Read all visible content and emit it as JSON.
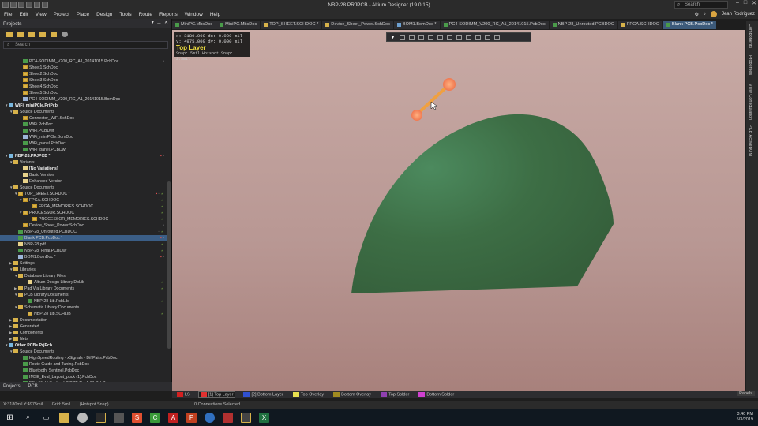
{
  "window": {
    "title": "NBP-28.PRJPCB - Altium Designer (19.0.15)",
    "search_placeholder": "Search",
    "user": "Jean Rodriguez"
  },
  "menu": [
    "File",
    "Edit",
    "View",
    "Project",
    "Place",
    "Design",
    "Tools",
    "Route",
    "Reports",
    "Window",
    "Help"
  ],
  "projects_panel": {
    "title": "Projects",
    "search_placeholder": "Search",
    "tree": [
      {
        "indent": 4,
        "icon": "pcb",
        "label": "PC4-SODIMM_V200_RC_A1_20141015.PcbDoc",
        "flags": "doc"
      },
      {
        "indent": 4,
        "icon": "sch",
        "label": "Sheet1.SchDoc"
      },
      {
        "indent": 4,
        "icon": "sch",
        "label": "Sheet2.SchDoc"
      },
      {
        "indent": 4,
        "icon": "sch",
        "label": "Sheet3.SchDoc"
      },
      {
        "indent": 4,
        "icon": "sch",
        "label": "Sheet4.SchDoc"
      },
      {
        "indent": 4,
        "icon": "sch",
        "label": "Sheet5.SchDoc"
      },
      {
        "indent": 4,
        "icon": "bom",
        "label": "PC4-SODIMM_V200_RC_A1_20141015.BomDoc"
      },
      {
        "indent": 1,
        "icon": "prj",
        "label": "WiFi_miniPCIe.PrjPcb",
        "bold": true,
        "tri": "▼"
      },
      {
        "indent": 2,
        "icon": "folder",
        "label": "Source Documents",
        "tri": "▼"
      },
      {
        "indent": 4,
        "icon": "sch",
        "label": "Connector_WiFi.SchDoc"
      },
      {
        "indent": 4,
        "icon": "pcb",
        "label": "WiFi.PcbDoc"
      },
      {
        "indent": 4,
        "icon": "pcb",
        "label": "WiFi.PCBDwf"
      },
      {
        "indent": 4,
        "icon": "bom",
        "label": "WiFi_miniPCIe.BomDoc"
      },
      {
        "indent": 4,
        "icon": "pcb",
        "label": "WiFi_panel.PcbDoc"
      },
      {
        "indent": 4,
        "icon": "pcb",
        "label": "WiFi_panel.PCBDwf"
      },
      {
        "indent": 1,
        "icon": "prj",
        "label": "NBP-28.PRJPCB *",
        "bold": true,
        "tri": "▼",
        "flags": "red-doc"
      },
      {
        "indent": 2,
        "icon": "folder",
        "label": "Variants",
        "tri": "▼"
      },
      {
        "indent": 4,
        "icon": "doc",
        "label": "[No Variations]",
        "bold": true
      },
      {
        "indent": 4,
        "icon": "doc",
        "label": "Basic Version"
      },
      {
        "indent": 4,
        "icon": "doc",
        "label": "Enhanced Version"
      },
      {
        "indent": 2,
        "icon": "folder",
        "label": "Source Documents",
        "tri": "▼"
      },
      {
        "indent": 3,
        "icon": "sch",
        "label": "TOP_SHEET.SCHDOC *",
        "tri": "▼",
        "flags": "red-doc-check"
      },
      {
        "indent": 4,
        "icon": "sch",
        "label": "FPGA.SCHDOC",
        "tri": "▼",
        "flags": "doc-check"
      },
      {
        "indent": 6,
        "icon": "sch",
        "label": "FPGA_MEMORIES.SCHDOC",
        "flags": "check"
      },
      {
        "indent": 4,
        "icon": "sch",
        "label": "PROCESSOR.SCHDOC",
        "tri": "▼",
        "flags": "check"
      },
      {
        "indent": 6,
        "icon": "sch",
        "label": "PROCESSOR_MEMORIES.SCHDOC",
        "flags": "check"
      },
      {
        "indent": 4,
        "icon": "sch",
        "label": "Device_Sheet_Power.SchDoc",
        "flags": "doc"
      },
      {
        "indent": 3,
        "icon": "pcb",
        "label": "NBP-28_Unrouted.PCBDOC",
        "flags": "doc-check"
      },
      {
        "indent": 3,
        "icon": "pcb",
        "label": "Blank PCB.PcbDoc *",
        "selected": true,
        "flags": "red-doc"
      },
      {
        "indent": 3,
        "icon": "doc",
        "label": "NBP-28.pdf",
        "flags": "check"
      },
      {
        "indent": 3,
        "icon": "pcb",
        "label": "NBP-28_Final.PCBDwf",
        "flags": "check"
      },
      {
        "indent": 3,
        "icon": "bom",
        "label": "BOM1.BomDoc *",
        "flags": "red-doc"
      },
      {
        "indent": 2,
        "icon": "folder",
        "label": "Settings",
        "tri": "▶"
      },
      {
        "indent": 2,
        "icon": "folder",
        "label": "Libraries",
        "tri": "▼"
      },
      {
        "indent": 3,
        "icon": "folder",
        "label": "Database Library Files",
        "tri": "▼"
      },
      {
        "indent": 5,
        "icon": "doc",
        "label": "Altium Design Library.DbLib",
        "flags": "check"
      },
      {
        "indent": 3,
        "icon": "folder",
        "label": "Pad Via Library Documents",
        "tri": "▶",
        "flags": "check"
      },
      {
        "indent": 3,
        "icon": "folder",
        "label": "PCB Library Documents",
        "tri": "▼"
      },
      {
        "indent": 5,
        "icon": "pcb",
        "label": "NBP-28 Lib.PcbLib",
        "flags": "check"
      },
      {
        "indent": 3,
        "icon": "folder",
        "label": "Schematic Library Documents",
        "tri": "▼"
      },
      {
        "indent": 5,
        "icon": "sch",
        "label": "NBP-28 Lib.SCHLIB",
        "flags": "check"
      },
      {
        "indent": 2,
        "icon": "folder",
        "label": "Documentation",
        "tri": "▶"
      },
      {
        "indent": 2,
        "icon": "folder",
        "label": "Generated",
        "tri": "▶"
      },
      {
        "indent": 2,
        "icon": "folder",
        "label": "Components",
        "tri": "▶"
      },
      {
        "indent": 2,
        "icon": "folder",
        "label": "Nets",
        "tri": "▶"
      },
      {
        "indent": 1,
        "icon": "prj",
        "label": "Other PCBs.PrjPcb",
        "bold": true,
        "tri": "▼"
      },
      {
        "indent": 2,
        "icon": "folder",
        "label": "Source Documents",
        "tri": "▼"
      },
      {
        "indent": 4,
        "icon": "pcb",
        "label": "HighSpeedRouting - xSignals - DiffPairs.PcbDoc"
      },
      {
        "indent": 4,
        "icon": "pcb",
        "label": "Route Guide and Tuning.PcbDoc"
      },
      {
        "indent": 4,
        "icon": "pcb",
        "label": "Bluetooth_Sentinel.PcbDoc"
      },
      {
        "indent": 4,
        "icon": "pcb",
        "label": "IMSE_Eval_Layout_puck (1).PcbDoc"
      },
      {
        "indent": 4,
        "icon": "pcb",
        "label": "ESA Flight Testing V2 PCB Rev1.01.PcbDoc"
      }
    ],
    "footer": [
      "Projects",
      "PCB"
    ]
  },
  "tabs": [
    {
      "label": "MiniPC.MbsDoc",
      "icon": "p"
    },
    {
      "label": "MiniPC.MbsDoc",
      "icon": "p"
    },
    {
      "label": "TOP_SHEET.SCHDOC *",
      "icon": "s"
    },
    {
      "label": "Device_Sheet_Power.SchDoc",
      "icon": "s"
    },
    {
      "label": "BOM1.BomDoc *",
      "icon": "b"
    },
    {
      "label": "PC4-SODIMM_V200_RC_A1_20141015.PcbDoc",
      "icon": "p"
    },
    {
      "label": "NBP-28_Unrouted.PCBDOC",
      "icon": "p"
    },
    {
      "label": "FPGA.SCHDOC",
      "icon": "s"
    },
    {
      "label": "Blank PCB.PcbDoc *",
      "icon": "p",
      "active": true
    }
  ],
  "hud": {
    "x_line": "x: 3180.000  dx:    0.000 mil",
    "y_line": "y: 4975.000  dy:    0.000 mil",
    "layer": "Top Layer",
    "snap": "Snap: 5mil Hotspot Snap: 2.5mil"
  },
  "right_strip": [
    "Components",
    "Properties",
    "View Configuration",
    "PCB ActiveBOM"
  ],
  "layers": [
    {
      "label": "LS",
      "color": "#d42020",
      "plain": true
    },
    {
      "label": "[1] Top Layer",
      "color": "#e03030",
      "active": true
    },
    {
      "label": "[2] Bottom Layer",
      "color": "#3050d0"
    },
    {
      "label": "Top Overlay",
      "color": "#e8e050"
    },
    {
      "label": "Bottom Overlay",
      "color": "#a08a20"
    },
    {
      "label": "Top Solder",
      "color": "#9040b0"
    },
    {
      "label": "Bottom Solder",
      "color": "#d040d0"
    }
  ],
  "panels_btn": "Panels",
  "status": {
    "coords": "X:3180mil Y:4975mil",
    "grid": "Grid: 5mil",
    "snap": "(Hotspot Snap)",
    "connections": "0 Connections Selected"
  },
  "clock": {
    "time": "3:40 PM",
    "date": "5/3/2019"
  },
  "colors": {
    "board": "#3f6e3f",
    "background_top": "#c8aaa5",
    "active_tab": "#3c5a7a"
  }
}
